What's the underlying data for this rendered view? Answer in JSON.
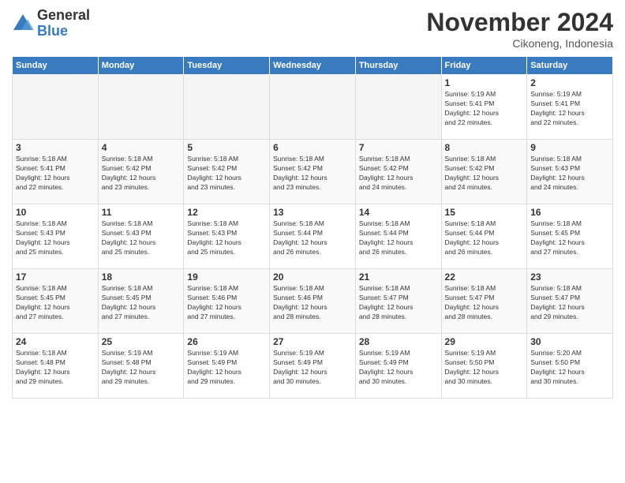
{
  "logo": {
    "general": "General",
    "blue": "Blue"
  },
  "header": {
    "month": "November 2024",
    "location": "Cikoneng, Indonesia"
  },
  "weekdays": [
    "Sunday",
    "Monday",
    "Tuesday",
    "Wednesday",
    "Thursday",
    "Friday",
    "Saturday"
  ],
  "weeks": [
    [
      {
        "day": "",
        "info": ""
      },
      {
        "day": "",
        "info": ""
      },
      {
        "day": "",
        "info": ""
      },
      {
        "day": "",
        "info": ""
      },
      {
        "day": "",
        "info": ""
      },
      {
        "day": "1",
        "info": "Sunrise: 5:19 AM\nSunset: 5:41 PM\nDaylight: 12 hours\nand 22 minutes."
      },
      {
        "day": "2",
        "info": "Sunrise: 5:19 AM\nSunset: 5:41 PM\nDaylight: 12 hours\nand 22 minutes."
      }
    ],
    [
      {
        "day": "3",
        "info": "Sunrise: 5:18 AM\nSunset: 5:41 PM\nDaylight: 12 hours\nand 22 minutes."
      },
      {
        "day": "4",
        "info": "Sunrise: 5:18 AM\nSunset: 5:42 PM\nDaylight: 12 hours\nand 23 minutes."
      },
      {
        "day": "5",
        "info": "Sunrise: 5:18 AM\nSunset: 5:42 PM\nDaylight: 12 hours\nand 23 minutes."
      },
      {
        "day": "6",
        "info": "Sunrise: 5:18 AM\nSunset: 5:42 PM\nDaylight: 12 hours\nand 23 minutes."
      },
      {
        "day": "7",
        "info": "Sunrise: 5:18 AM\nSunset: 5:42 PM\nDaylight: 12 hours\nand 24 minutes."
      },
      {
        "day": "8",
        "info": "Sunrise: 5:18 AM\nSunset: 5:42 PM\nDaylight: 12 hours\nand 24 minutes."
      },
      {
        "day": "9",
        "info": "Sunrise: 5:18 AM\nSunset: 5:43 PM\nDaylight: 12 hours\nand 24 minutes."
      }
    ],
    [
      {
        "day": "10",
        "info": "Sunrise: 5:18 AM\nSunset: 5:43 PM\nDaylight: 12 hours\nand 25 minutes."
      },
      {
        "day": "11",
        "info": "Sunrise: 5:18 AM\nSunset: 5:43 PM\nDaylight: 12 hours\nand 25 minutes."
      },
      {
        "day": "12",
        "info": "Sunrise: 5:18 AM\nSunset: 5:43 PM\nDaylight: 12 hours\nand 25 minutes."
      },
      {
        "day": "13",
        "info": "Sunrise: 5:18 AM\nSunset: 5:44 PM\nDaylight: 12 hours\nand 26 minutes."
      },
      {
        "day": "14",
        "info": "Sunrise: 5:18 AM\nSunset: 5:44 PM\nDaylight: 12 hours\nand 26 minutes."
      },
      {
        "day": "15",
        "info": "Sunrise: 5:18 AM\nSunset: 5:44 PM\nDaylight: 12 hours\nand 26 minutes."
      },
      {
        "day": "16",
        "info": "Sunrise: 5:18 AM\nSunset: 5:45 PM\nDaylight: 12 hours\nand 27 minutes."
      }
    ],
    [
      {
        "day": "17",
        "info": "Sunrise: 5:18 AM\nSunset: 5:45 PM\nDaylight: 12 hours\nand 27 minutes."
      },
      {
        "day": "18",
        "info": "Sunrise: 5:18 AM\nSunset: 5:45 PM\nDaylight: 12 hours\nand 27 minutes."
      },
      {
        "day": "19",
        "info": "Sunrise: 5:18 AM\nSunset: 5:46 PM\nDaylight: 12 hours\nand 27 minutes."
      },
      {
        "day": "20",
        "info": "Sunrise: 5:18 AM\nSunset: 5:46 PM\nDaylight: 12 hours\nand 28 minutes."
      },
      {
        "day": "21",
        "info": "Sunrise: 5:18 AM\nSunset: 5:47 PM\nDaylight: 12 hours\nand 28 minutes."
      },
      {
        "day": "22",
        "info": "Sunrise: 5:18 AM\nSunset: 5:47 PM\nDaylight: 12 hours\nand 28 minutes."
      },
      {
        "day": "23",
        "info": "Sunrise: 5:18 AM\nSunset: 5:47 PM\nDaylight: 12 hours\nand 29 minutes."
      }
    ],
    [
      {
        "day": "24",
        "info": "Sunrise: 5:18 AM\nSunset: 5:48 PM\nDaylight: 12 hours\nand 29 minutes."
      },
      {
        "day": "25",
        "info": "Sunrise: 5:19 AM\nSunset: 5:48 PM\nDaylight: 12 hours\nand 29 minutes."
      },
      {
        "day": "26",
        "info": "Sunrise: 5:19 AM\nSunset: 5:49 PM\nDaylight: 12 hours\nand 29 minutes."
      },
      {
        "day": "27",
        "info": "Sunrise: 5:19 AM\nSunset: 5:49 PM\nDaylight: 12 hours\nand 30 minutes."
      },
      {
        "day": "28",
        "info": "Sunrise: 5:19 AM\nSunset: 5:49 PM\nDaylight: 12 hours\nand 30 minutes."
      },
      {
        "day": "29",
        "info": "Sunrise: 5:19 AM\nSunset: 5:50 PM\nDaylight: 12 hours\nand 30 minutes."
      },
      {
        "day": "30",
        "info": "Sunrise: 5:20 AM\nSunset: 5:50 PM\nDaylight: 12 hours\nand 30 minutes."
      }
    ]
  ]
}
